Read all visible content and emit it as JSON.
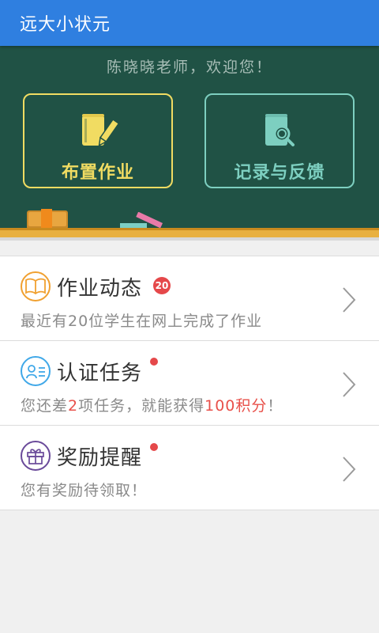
{
  "app": {
    "title": "远大小状元"
  },
  "board": {
    "welcome": "陈晓晓老师，欢迎您！",
    "assign_label": "布置作业",
    "record_label": "记录与反馈"
  },
  "items": [
    {
      "title": "作业动态",
      "badge": "20",
      "sub": "最近有20位学生在网上完成了作业",
      "icon": "book-icon"
    },
    {
      "title": "认证任务",
      "sub_a": "您还差",
      "sub_b": "2",
      "sub_c": "项任务，就能获得",
      "sub_d": "100积分",
      "sub_e": "！",
      "icon": "id-card-icon"
    },
    {
      "title": "奖励提醒",
      "sub": "您有奖励待领取！",
      "icon": "gift-icon"
    }
  ],
  "colors": {
    "appbar": "#2f7fe0",
    "board": "#205245",
    "assign": "#f1dc62",
    "record": "#7dcfc0",
    "highlight": "#e8504a"
  }
}
